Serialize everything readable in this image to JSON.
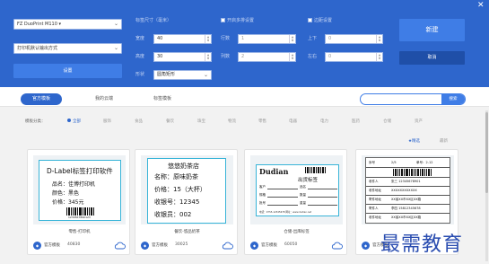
{
  "panel": {
    "printer_select": "FZ DuoPrint M110 ▾",
    "printer_mode_select": "打印机默认输出方式",
    "settings_button": "设置",
    "size_section_label": "标签尺寸（毫米）",
    "width_label": "宽度",
    "width_value": "40",
    "height_label": "高度",
    "height_value": "30",
    "shape_label": "形状",
    "shape_value": "圆角矩形",
    "multi_label_checkbox": "开启多排设置",
    "rows_label": "行数",
    "rows_value": "1",
    "cols_label": "列数",
    "cols_value": "2",
    "margin_checkbox": "边距设置",
    "top_label": "上下",
    "top_value": "0",
    "side_label": "左右",
    "side_value": "0",
    "new_button": "新建",
    "cancel_button": "取消",
    "close": "✕"
  },
  "tabs": [
    "官方模板",
    "我的云端",
    "标签模板"
  ],
  "search": {
    "placeholder": "",
    "button": "搜索"
  },
  "filter": {
    "label": "模板分类：",
    "categories": [
      "全部",
      "服饰",
      "食品",
      "餐饮",
      "珠宝",
      "物流",
      "零售",
      "电器",
      "电力",
      "医药",
      "仓储",
      "资产"
    ],
    "sort_featured": "精选",
    "sort_latest": "最新"
  },
  "cards": [
    {
      "title": "零售-打印机",
      "source": "官方模板",
      "count": "40830"
    },
    {
      "title": "餐饮-悠品奶茶",
      "source": "官方模板",
      "count": "30025"
    },
    {
      "title": "仓储-出库标签",
      "source": "官方模板",
      "count": "60050"
    },
    {
      "title": "",
      "source": "官方模板",
      "count": ""
    }
  ],
  "label1": {
    "heading": "D-Label标签打印软件",
    "line1": "品名：佳博打印机",
    "line2": "颜色：黑色",
    "line3": "价格：345元",
    "barcode_text": "1234567890123"
  },
  "label2": {
    "heading": "悠悠奶茶店",
    "line1": "名称：原味奶茶",
    "line2": "价格：15（大杯）",
    "line3": "收银号：12345",
    "line4": "收银员：002"
  },
  "label3": {
    "brand": "Dudian",
    "title": "出货标签",
    "f1": "客户",
    "f2": "品名",
    "f3": "规格",
    "f4": "数量",
    "f5": "批号",
    "f6": "重量",
    "footer": "电话：0755-12345678  网址：www.dudian.net"
  },
  "label4": {
    "r1a": "序号",
    "r1b": "2/5",
    "r1c": "单号：2-12",
    "r2a": "收件人",
    "r2b": "张三 12345678901",
    "r3a": "收件地址",
    "r3b": "XXXXXXXXXXXX",
    "r4a": "寄件地址",
    "r4b": "XX省XX市XX区XX路",
    "r5a": "寄件人",
    "r5b": "李四 15812345678",
    "r6a": "收件地址",
    "r6b": "XX省XX市XX区XX路"
  },
  "watermark": "最需教育"
}
